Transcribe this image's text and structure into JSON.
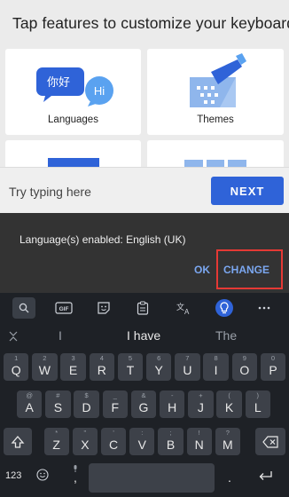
{
  "header": {
    "title": "Tap features to customize your keyboard"
  },
  "cards": [
    {
      "id": "languages",
      "label": "Languages",
      "bubble_left": "你好",
      "bubble_right": "Hi"
    },
    {
      "id": "themes",
      "label": "Themes"
    }
  ],
  "typing": {
    "placeholder": "Try typing here",
    "next_label": "NEXT"
  },
  "snackbar": {
    "message": "Language(s) enabled: English (UK)",
    "ok_label": "OK",
    "change_label": "CHANGE"
  },
  "keyboard": {
    "toolbar": [
      {
        "name": "search-icon",
        "glyph": "⌕"
      },
      {
        "name": "gif-icon",
        "glyph": "GIF"
      },
      {
        "name": "sticker-icon",
        "glyph": "☺"
      },
      {
        "name": "clipboard-icon",
        "glyph": "📋"
      },
      {
        "name": "translate-icon",
        "glyph": "文"
      },
      {
        "name": "theme-bulb-icon",
        "glyph": "💡"
      },
      {
        "name": "more-icon",
        "glyph": "⋯"
      }
    ],
    "suggestions": {
      "left": "I",
      "center": "I have",
      "right": "The"
    },
    "row1": [
      {
        "k": "Q",
        "h": "1"
      },
      {
        "k": "W",
        "h": "2"
      },
      {
        "k": "E",
        "h": "3"
      },
      {
        "k": "R",
        "h": "4"
      },
      {
        "k": "T",
        "h": "5"
      },
      {
        "k": "Y",
        "h": "6"
      },
      {
        "k": "U",
        "h": "7"
      },
      {
        "k": "I",
        "h": "8"
      },
      {
        "k": "O",
        "h": "9"
      },
      {
        "k": "P",
        "h": "0"
      }
    ],
    "row2": [
      {
        "k": "A",
        "h": "@"
      },
      {
        "k": "S",
        "h": "#"
      },
      {
        "k": "D",
        "h": "$"
      },
      {
        "k": "F",
        "h": "_"
      },
      {
        "k": "G",
        "h": "&"
      },
      {
        "k": "H",
        "h": "-"
      },
      {
        "k": "J",
        "h": "+"
      },
      {
        "k": "K",
        "h": "("
      },
      {
        "k": "L",
        "h": ")"
      }
    ],
    "row3": [
      {
        "k": "Z",
        "h": "*"
      },
      {
        "k": "X",
        "h": "\""
      },
      {
        "k": "C",
        "h": "'"
      },
      {
        "k": "V",
        "h": ":"
      },
      {
        "k": "B",
        "h": ";"
      },
      {
        "k": "N",
        "h": "!"
      },
      {
        "k": "M",
        "h": "?"
      }
    ],
    "bottom": {
      "numbers_label": "123",
      "comma": ",",
      "period": "."
    }
  }
}
